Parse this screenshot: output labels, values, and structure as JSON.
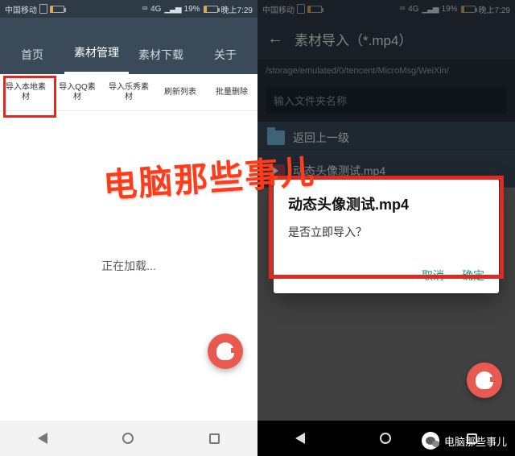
{
  "status": {
    "carrier": "中国移动",
    "net_label": "4G",
    "battery_pct": "19%",
    "time": "晚上7:29"
  },
  "left": {
    "tabs": [
      "首页",
      "素材管理",
      "素材下载",
      "关于"
    ],
    "active_tab_index": 1,
    "subtabs": [
      {
        "l1": "导入本地素",
        "l2": "材"
      },
      {
        "l1": "导入QQ素",
        "l2": "材"
      },
      {
        "l1": "导入乐秀素",
        "l2": "材"
      },
      {
        "l1": "刷新列表",
        "l2": ""
      },
      {
        "l1": "批量删除",
        "l2": ""
      }
    ],
    "loading_text": "正在加载..."
  },
  "right": {
    "appbar_title": "素材导入（*.mp4）",
    "path": "/storage/emulated/0/tencent/MicroMsg/WeiXin/",
    "search_placeholder": "输入文件夹名称",
    "rows": [
      {
        "type": "folder",
        "label": "返回上一级"
      },
      {
        "type": "video",
        "label": "动态头像测试.mp4"
      }
    ],
    "dialog": {
      "title": "动态头像测试.mp4",
      "message": "是否立即导入？",
      "cancel": "取消",
      "ok": "确定"
    }
  },
  "watermark": "电脑那些事儿",
  "brand": "电脑那些事儿"
}
